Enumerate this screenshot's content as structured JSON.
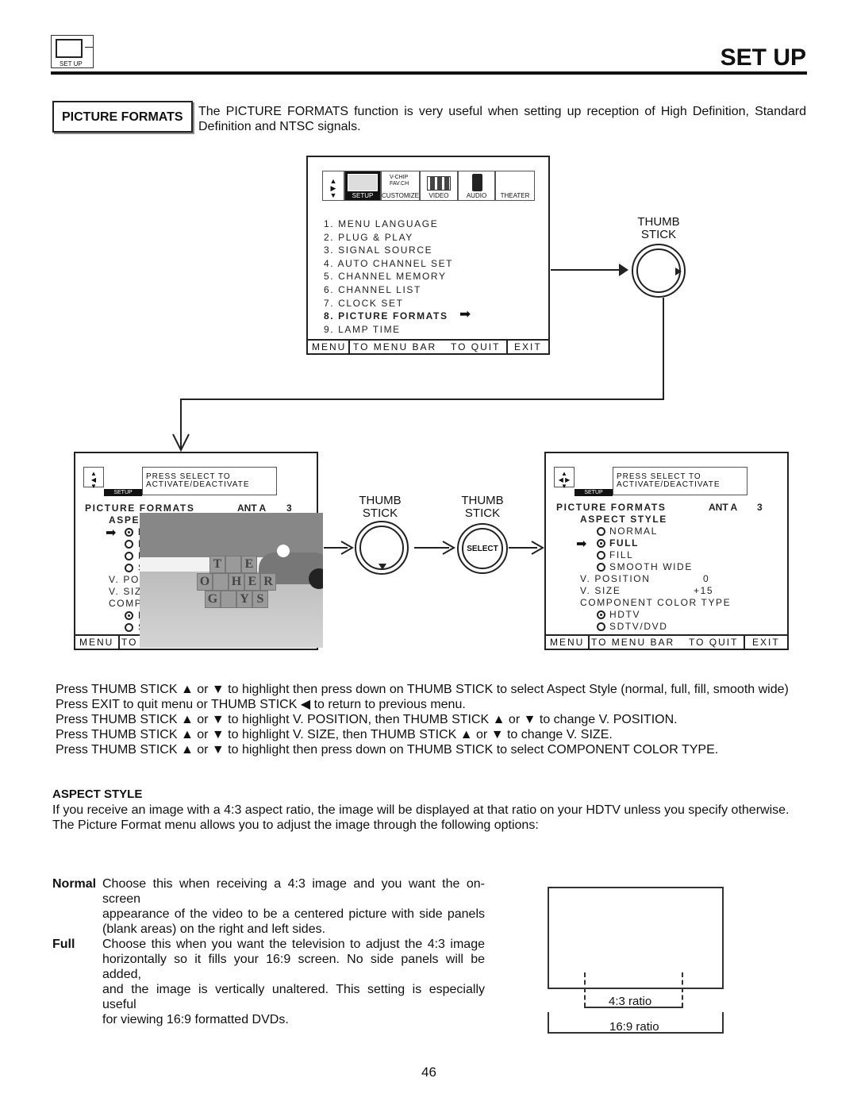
{
  "header": {
    "icon_label": "SET UP",
    "title": "SET UP"
  },
  "section": {
    "label": "PICTURE FORMATS",
    "intro": "The PICTURE FORMATS function is very useful when setting up reception of High Definition, Standard Definition and NTSC signals."
  },
  "main_menu": {
    "tabs": [
      "SETUP",
      "CUSTOMIZE",
      "VIDEO",
      "AUDIO",
      "THEATER"
    ],
    "customize_icon_text": [
      "V-CHIP",
      "FAV.CH"
    ],
    "items": [
      "1. MENU LANGUAGE",
      "2. PLUG & PLAY",
      "3. SIGNAL SOURCE",
      "4. AUTO CHANNEL SET",
      "5. CHANNEL MEMORY",
      "6. CHANNEL LIST",
      "7. CLOCK SET",
      "8. PICTURE FORMATS",
      "9. LAMP TIME"
    ],
    "selected_index": 7,
    "bar": {
      "menu": "MENU",
      "to_menu_bar": "TO MENU BAR",
      "to_quit": "TO QUIT",
      "exit": "EXIT"
    }
  },
  "thumb_stick_label": [
    "THUMB",
    "STICK"
  ],
  "select_label": "SELECT",
  "left_screen": {
    "tab": "SETUP",
    "message": [
      "PRESS SELECT TO",
      "ACTIVATE/DEACTIVATE"
    ],
    "title": "PICTURE FORMATS",
    "input": "ANT A",
    "channel": "3",
    "rows": [
      "ASPEC",
      "N",
      "F",
      "F",
      "S",
      "V. POS",
      "V. SIZ",
      "COMP",
      "H",
      "S"
    ],
    "bar": {
      "menu": "MENU",
      "to": "TO"
    },
    "image_letters": [
      "T",
      "E",
      "O",
      "H",
      "E",
      "R",
      "G",
      "Y",
      "S"
    ]
  },
  "right_screen": {
    "tab": "SETUP",
    "message": [
      "PRESS SELECT TO",
      "ACTIVATE/DEACTIVATE"
    ],
    "title": "PICTURE FORMATS",
    "input": "ANT A",
    "channel": "3",
    "aspect_style": "ASPECT STYLE",
    "options": [
      "NORMAL",
      "FULL",
      "FILL",
      "SMOOTH WIDE"
    ],
    "selected_option": "FULL",
    "v_position": {
      "label": "V. POSITION",
      "value": "0"
    },
    "v_size": {
      "label": "V. SIZE",
      "value": "+15"
    },
    "component": "COMPONENT COLOR TYPE",
    "color_options": [
      "HDTV",
      "SDTV/DVD"
    ],
    "selected_color": "HDTV",
    "bar": {
      "menu": "MENU",
      "to_menu_bar": "TO MENU BAR",
      "to_quit": "TO QUIT",
      "exit": "EXIT"
    }
  },
  "instructions": [
    "Press THUMB STICK ▲ or ▼ to highlight then press down on THUMB STICK to select Aspect Style (normal, full, fill, smooth wide)",
    "Press EXIT to quit menu or THUMB STICK ◀ to return to previous menu.",
    "Press THUMB STICK ▲ or ▼ to highlight V. POSITION, then THUMB STICK ▲ or ▼ to change V. POSITION.",
    "Press THUMB STICK ▲ or ▼ to highlight V. SIZE, then THUMB STICK ▲ or ▼ to change V. SIZE.",
    "Press THUMB STICK ▲ or ▼ to highlight then press down on THUMB STICK to select COMPONENT COLOR TYPE."
  ],
  "aspect": {
    "heading": "ASPECT STYLE",
    "text": [
      "If you receive an image with a 4:3 aspect ratio, the image will be displayed at that ratio on your HDTV unless you specify otherwise.",
      "The Picture Format menu allows you to adjust the image through the following options:"
    ]
  },
  "normal": {
    "term": "Normal",
    "lines": [
      "Choose this when receiving a 4:3 image and you want the on-screen",
      "appearance of the video to be a centered picture with side panels",
      "(blank areas) on the right and left sides."
    ]
  },
  "full": {
    "term": "Full",
    "lines": [
      "Choose this when you want the television to adjust the 4:3 image",
      "horizontally so it fills your 16:9 screen. No side panels will be added,",
      "and the image is vertically unaltered. This setting is especially useful",
      "for viewing 16:9 formatted DVDs."
    ]
  },
  "diagram": {
    "ratio_43": "4:3 ratio",
    "ratio_169": "16:9 ratio"
  },
  "page_number": "46"
}
